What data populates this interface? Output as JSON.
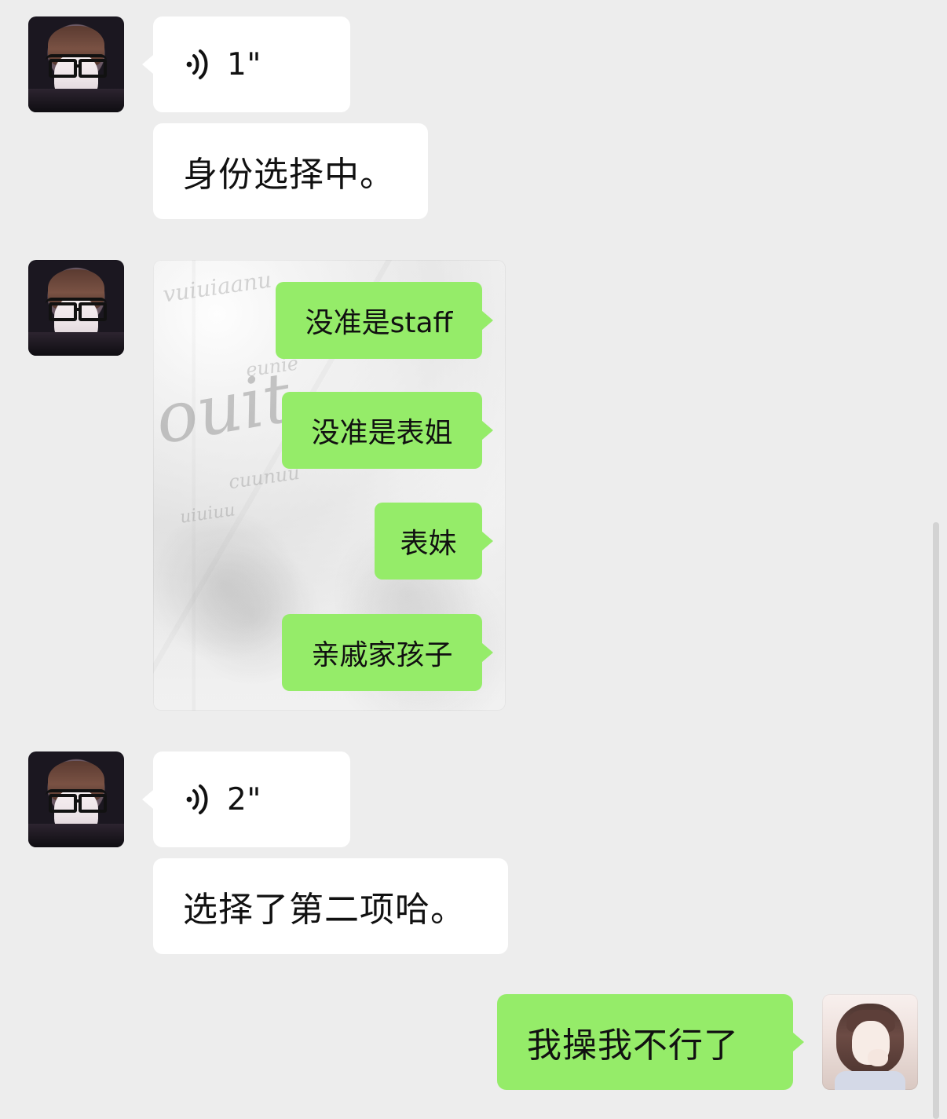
{
  "chat": {
    "messages": [
      {
        "type": "voice",
        "duration": "1\""
      },
      {
        "type": "text",
        "text": "身份选择中。"
      },
      {
        "type": "sticker",
        "bubbles": [
          "没准是staff",
          "没准是表姐",
          "表妹",
          "亲戚家孩子"
        ],
        "decorative_words": [
          "ouit...",
          "vuiuiaanu",
          "eunie",
          "cuunuu",
          "uiuiuu"
        ]
      },
      {
        "type": "voice",
        "duration": "2\""
      },
      {
        "type": "text",
        "text": "选择了第二项哈。"
      },
      {
        "type": "text",
        "text": "我操我不行了"
      }
    ]
  },
  "theme": {
    "background": "#ededed",
    "incoming_bubble": "#ffffff",
    "outgoing_bubble": "#95ec69",
    "text": "#111111"
  },
  "icons": {
    "voice": "voice-wave-icon"
  }
}
